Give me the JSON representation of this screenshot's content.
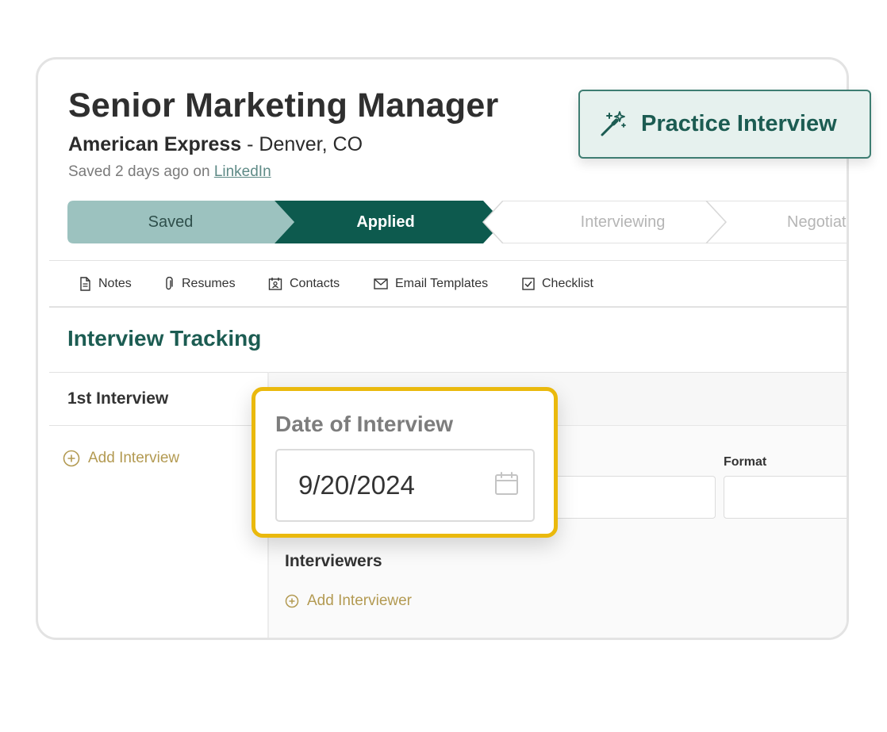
{
  "job": {
    "title": "Senior Marketing Manager",
    "company": "American Express",
    "separator": " - ",
    "location": "Denver, CO",
    "saved_prefix": "Saved 2 days ago on ",
    "saved_source": "LinkedIn"
  },
  "practice_button": {
    "label": "Practice Interview",
    "icon": "magic-wand-icon"
  },
  "pipeline": {
    "stages": [
      "Saved",
      "Applied",
      "Interviewing",
      "Negotiating"
    ],
    "active": "Applied"
  },
  "tabs": [
    {
      "label": "Notes",
      "icon": "document-icon"
    },
    {
      "label": "Resumes",
      "icon": "paperclip-icon"
    },
    {
      "label": "Contacts",
      "icon": "contact-card-icon"
    },
    {
      "label": "Email Templates",
      "icon": "envelope-icon"
    },
    {
      "label": "Checklist",
      "icon": "checkbox-icon"
    }
  ],
  "tracking": {
    "title": "Interview Tracking",
    "interview_tab": "1st Interview",
    "add_interview": "Add Interview",
    "format_label": "Format",
    "interviewers_label": "Interviewers",
    "add_interviewer": "Add Interviewer"
  },
  "date_popup": {
    "title": "Date of Interview",
    "value": "9/20/2024",
    "icon": "calendar-icon"
  },
  "colors": {
    "accent_dark": "#0d5a4e",
    "accent_light": "#9cc2bf",
    "gold": "#eab90d",
    "link_gold": "#b39a52"
  }
}
